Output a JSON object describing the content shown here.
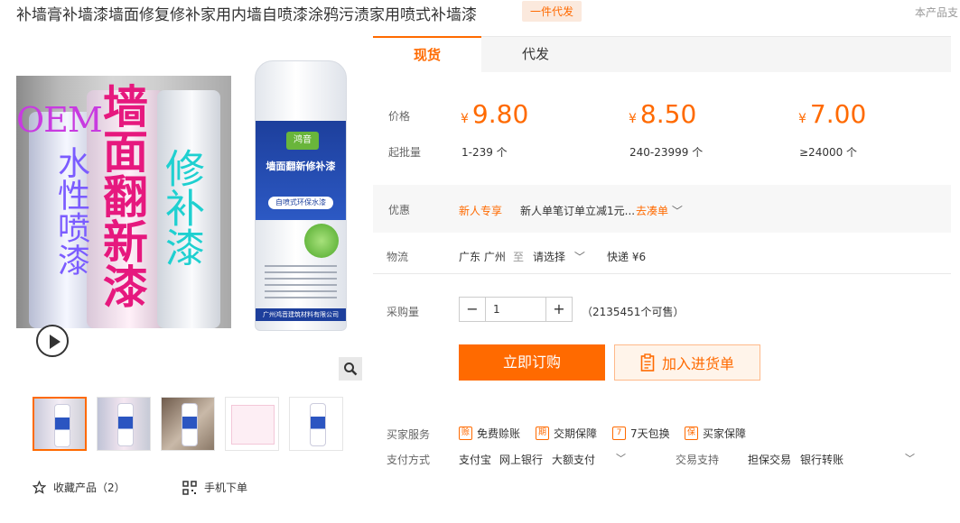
{
  "product": {
    "title": "补墙膏补墙漆墙面修复修补家用内墙自喷漆涂鸦污渍家用喷式补墙漆",
    "tag": "一件代发",
    "top_right_note": "本产品支"
  },
  "gallery": {
    "overlay": {
      "oem": "OEM",
      "water": "水性喷漆",
      "wall": "墙面翻新漆",
      "fix": "修补漆"
    },
    "can": {
      "brand": "鸿音",
      "title": "墙面翻新修补漆",
      "subtitle": "自喷式环保水漆",
      "bottom": "广州鸿音建筑材料有限公司"
    },
    "thumbs_count": 5
  },
  "actions_left": {
    "favorite": "收藏产品（2）",
    "mobile_order": "手机下单"
  },
  "tabs": [
    "现货",
    "代发"
  ],
  "price_label": "价格",
  "batch_label": "起批量",
  "currency": "¥",
  "tiers": [
    {
      "price": "9.80",
      "range": "1-239 个"
    },
    {
      "price": "8.50",
      "range": "240-23999 个"
    },
    {
      "price": "7.00",
      "range": "≥24000 个"
    }
  ],
  "promo": {
    "label": "优惠",
    "badge": "新人专享",
    "text": "新人单笔订单立减1元...",
    "link": "去凑单"
  },
  "logistics": {
    "label": "物流",
    "from": "广东 广州",
    "to_word": "至",
    "select": "请选择",
    "express": "快递 ¥6"
  },
  "purchase": {
    "label": "采购量",
    "quantity": "1",
    "stock": "（2135451个可售）",
    "buy_now": "立即订购",
    "add_cart": "加入进货单"
  },
  "services": {
    "label": "买家服务",
    "items": [
      "免费赊账",
      "交期保障",
      "7天包换",
      "买家保障"
    ],
    "icons": [
      "赊",
      "期",
      "7",
      "保"
    ]
  },
  "payment": {
    "label": "支付方式",
    "methods": [
      "支付宝",
      "网上银行",
      "大额支付"
    ],
    "trade_label": "交易支持",
    "trade_methods": [
      "担保交易",
      "银行转账"
    ]
  },
  "colors": {
    "accent": "#ff6a00",
    "accent_light": "#fff4ea"
  }
}
